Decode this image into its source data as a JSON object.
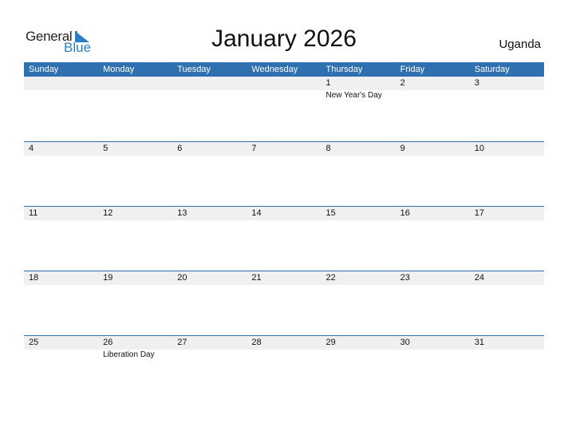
{
  "logo": {
    "general": "General",
    "blue": "Blue",
    "icon": "flag-triangle-icon"
  },
  "title": "January 2026",
  "country": "Uganda",
  "colors": {
    "accent": "#2f71b0",
    "strip": "#f0f0f0"
  },
  "weekdays": [
    "Sunday",
    "Monday",
    "Tuesday",
    "Wednesday",
    "Thursday",
    "Friday",
    "Saturday"
  ],
  "weeks": [
    {
      "days": [
        "",
        "",
        "",
        "",
        "1",
        "2",
        "3"
      ],
      "events": [
        "",
        "",
        "",
        "",
        "New Year's Day",
        "",
        ""
      ]
    },
    {
      "days": [
        "4",
        "5",
        "6",
        "7",
        "8",
        "9",
        "10"
      ],
      "events": [
        "",
        "",
        "",
        "",
        "",
        "",
        ""
      ]
    },
    {
      "days": [
        "11",
        "12",
        "13",
        "14",
        "15",
        "16",
        "17"
      ],
      "events": [
        "",
        "",
        "",
        "",
        "",
        "",
        ""
      ]
    },
    {
      "days": [
        "18",
        "19",
        "20",
        "21",
        "22",
        "23",
        "24"
      ],
      "events": [
        "",
        "",
        "",
        "",
        "",
        "",
        ""
      ]
    },
    {
      "days": [
        "25",
        "26",
        "27",
        "28",
        "29",
        "30",
        "31"
      ],
      "events": [
        "",
        "Liberation Day",
        "",
        "",
        "",
        "",
        ""
      ]
    }
  ]
}
